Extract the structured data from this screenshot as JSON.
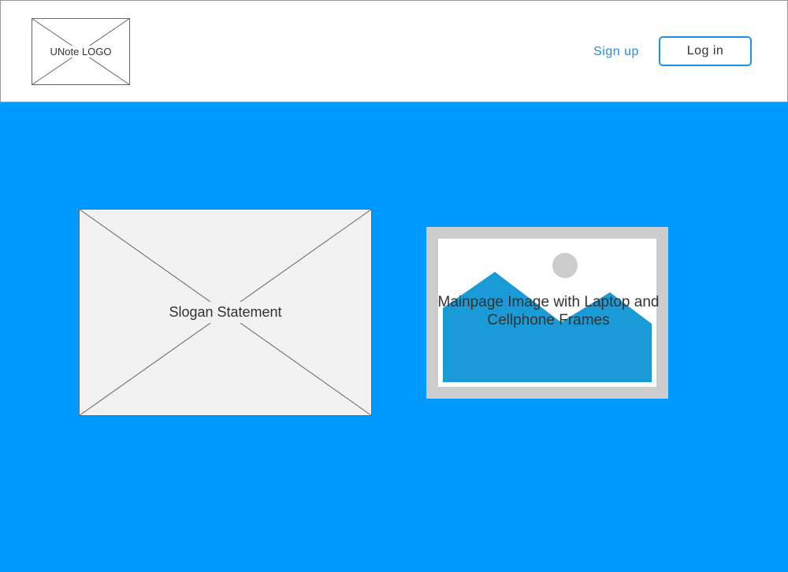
{
  "header": {
    "logo_label": "UNote LOGO",
    "signup_label": "Sign up",
    "login_label": "Log in"
  },
  "main": {
    "slogan_label": "Slogan Statement",
    "image_caption_line1": "Mainpage Image with Laptop and",
    "image_caption_line2": "Cellphone Frames"
  },
  "colors": {
    "page_background": "#0099ff",
    "accent": "#1e90e6",
    "placeholder_fill": "#f2f2f2",
    "image_frame": "#cccccc",
    "image_mountains": "#1a9ad6"
  },
  "icons": {
    "logo_placeholder": "x-box-placeholder",
    "slogan_placeholder": "x-box-placeholder",
    "main_image": "image-placeholder-icon"
  }
}
